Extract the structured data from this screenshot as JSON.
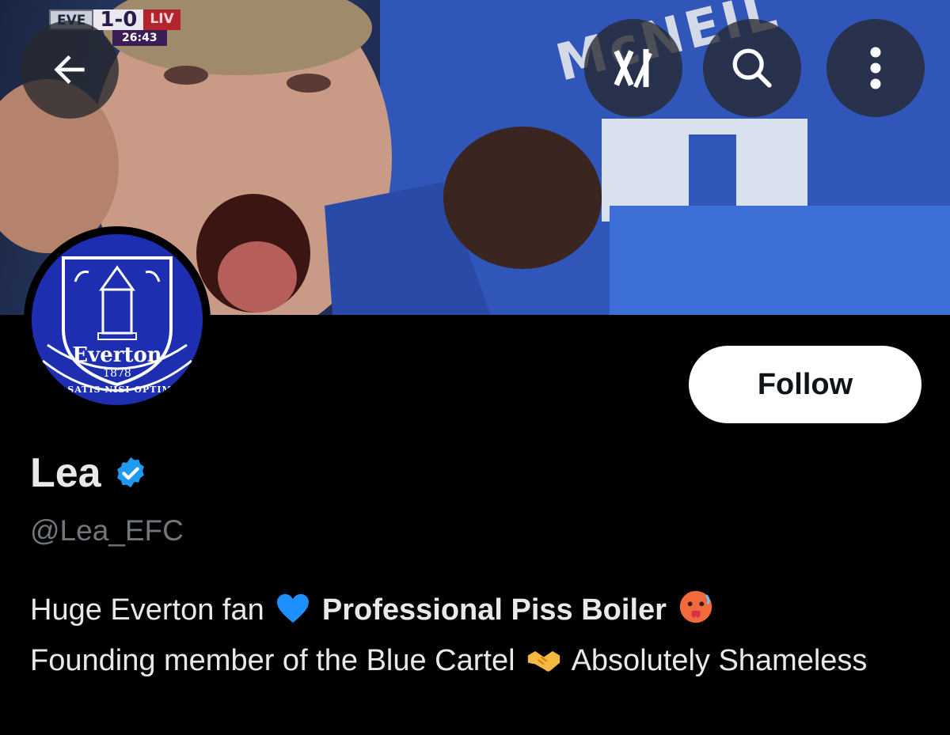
{
  "scorebug": {
    "home_team": "EVE",
    "score": "1-0",
    "away_team": "LIV",
    "clock": "26:43"
  },
  "banner": {
    "jersey_text": "McNEIL"
  },
  "header": {
    "back_icon": "arrow-left-icon",
    "grok_icon": "grok-icon",
    "search_icon": "search-icon",
    "more_icon": "more-vertical-icon"
  },
  "avatar": {
    "club_name": "Everton",
    "founded": "1878",
    "motto": "NIL SATIS NISI OPTIMUM"
  },
  "follow_label": "Follow",
  "profile": {
    "display_name": "Lea",
    "handle": "@Lea_EFC",
    "verified_icon": "verified-badge-icon"
  },
  "bio": {
    "part1": "Huge Everton fan",
    "emoji1": "blue-heart-emoji",
    "part2_bold": "Professional Piss Boiler",
    "emoji2": "hot-face-emoji",
    "part3": "Founding member of the Blue Cartel",
    "emoji3": "handshake-emoji",
    "part4": "Absolutely Shameless"
  },
  "colors": {
    "background": "#000000",
    "text_primary": "#e7e9ea",
    "text_secondary": "#71767b",
    "verified_blue": "#1d9bf0",
    "everton_blue": "#1d2fb0"
  }
}
